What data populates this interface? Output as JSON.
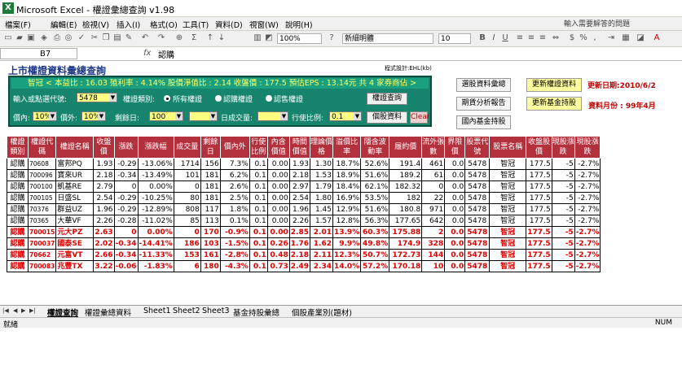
{
  "window": {
    "title": "Microsoft Excel - 權證彙總查詢 v1.98"
  },
  "menu": [
    "檔案(F)",
    "編輯(E)",
    "檢視(V)",
    "插入(I)",
    "格式(O)",
    "工具(T)",
    "資料(D)",
    "視窗(W)",
    "說明(H)"
  ],
  "help_box": "輸入需要解答的問題",
  "toolbar": {
    "zoom": "100%",
    "font_name": "新細明體",
    "font_size": "10"
  },
  "formula_bar": {
    "cell_ref": "B7",
    "fx": "fx",
    "value": "認購"
  },
  "page": {
    "title": "上市權證資料彙總查詢",
    "designer": "程式設計:EHL(kb)",
    "info_strip": "智冠 < 本益比 : 16.03 殖利率 : 4.14% 股價淨值比 : 2.14 收盤價 : 177.5 預估EPS : 13.14元 共 4 家券商佔 >",
    "update_date": "更新日期:2010/6/2",
    "data_month": "資料月份 : 99年4月"
  },
  "panel": {
    "code_label": "輸入或點選代號:",
    "code_value": "5478",
    "type_label": "權證類別:",
    "radio_all": "所有權證",
    "radio_call": "認購權證",
    "radio_put": "認售權證",
    "in_label": "價內:",
    "in_value": "10%",
    "out_label": "價外:",
    "out_value": "10%",
    "days_label": "剩餘日:",
    "days_value": "100",
    "tilde": "~",
    "volume_label": "日成交量:",
    "exercise_label": "行使比例:",
    "exercise_value": "0.1",
    "query_btn": "權證查詢",
    "info_btn": "個股資料",
    "clear_btn": "Clear"
  },
  "right_buttons": {
    "select_summary": "選股資料彙總",
    "futures_report": "期貨分析報告",
    "domestic_fund": "國內基金持股",
    "update_warrant": "更新權證資料",
    "update_fund": "更新基金持股"
  },
  "table": {
    "headers": [
      "權證類別",
      "權證代碼",
      "權證名稱",
      "收盤價",
      "漲跌",
      "漲跌幅",
      "成交量",
      "剩餘日",
      "價內外",
      "行使比例",
      "內含價值",
      "時間價值",
      "理論價格",
      "溢價比率",
      "隱含波動率",
      "履約價",
      "流外張數",
      "界限價",
      "股票代號",
      "股票名稱",
      "收盤股價",
      "現股漲跌",
      "現股漲跌"
    ],
    "rows": [
      [
        "認購",
        "70608",
        "富邦PQ",
        "1.93",
        "-0.29",
        "-13.06%",
        "1714",
        "156",
        "7.3%",
        "0.1",
        "0.00",
        "1.93",
        "1.30",
        "18.7%",
        "52.6%",
        "191.4",
        "461",
        "0.0",
        "5478",
        "智冠",
        "177.5",
        "-5",
        "-2.7%"
      ],
      [
        "認購",
        "700096",
        "寶來UR",
        "2.18",
        "-0.34",
        "-13.49%",
        "101",
        "181",
        "6.2%",
        "0.1",
        "0.00",
        "2.18",
        "1.53",
        "18.9%",
        "51.6%",
        "189.2",
        "61",
        "0.0",
        "5478",
        "智冠",
        "177.5",
        "-5",
        "-2.7%"
      ],
      [
        "認購",
        "700100",
        "凱基RE",
        "2.79",
        "0",
        "0.00%",
        "0",
        "181",
        "2.6%",
        "0.1",
        "0.00",
        "2.97",
        "1.79",
        "18.4%",
        "62.1%",
        "182.32",
        "0",
        "0.0",
        "5478",
        "智冠",
        "177.5",
        "-5",
        "-2.7%"
      ],
      [
        "認購",
        "700105",
        "日盛SL",
        "2.54",
        "-0.29",
        "-10.25%",
        "80",
        "181",
        "2.5%",
        "0.1",
        "0.00",
        "2.54",
        "1.80",
        "16.9%",
        "53.5%",
        "182",
        "22",
        "0.0",
        "5478",
        "智冠",
        "177.5",
        "-5",
        "-2.7%"
      ],
      [
        "認購",
        "70376",
        "群益UZ",
        "1.96",
        "-0.29",
        "-12.89%",
        "808",
        "117",
        "1.8%",
        "0.1",
        "0.00",
        "1.96",
        "1.45",
        "12.9%",
        "51.6%",
        "180.8",
        "971",
        "0.0",
        "5478",
        "智冠",
        "177.5",
        "-5",
        "-2.7%"
      ],
      [
        "認購",
        "70365",
        "大華VF",
        "2.26",
        "-0.28",
        "-11.02%",
        "85",
        "113",
        "0.1%",
        "0.1",
        "0.00",
        "2.26",
        "1.57",
        "12.8%",
        "56.3%",
        "177.65",
        "642",
        "0.0",
        "5478",
        "智冠",
        "177.5",
        "-5",
        "-2.7%"
      ],
      [
        "認購",
        "700015",
        "元大PZ",
        "2.63",
        "0",
        "0.00%",
        "0",
        "170",
        "-0.9%",
        "0.1",
        "0.00",
        "2.85",
        "2.01",
        "13.9%",
        "60.3%",
        "175.88",
        "2",
        "0.0",
        "5478",
        "智冠",
        "177.5",
        "-5",
        "-2.7%"
      ],
      [
        "認購",
        "700037",
        "國泰SE",
        "2.02",
        "-0.34",
        "-14.41%",
        "186",
        "103",
        "-1.5%",
        "0.1",
        "0.26",
        "1.76",
        "1.62",
        "9.9%",
        "49.8%",
        "174.9",
        "328",
        "0.0",
        "5478",
        "智冠",
        "177.5",
        "-5",
        "-2.7%"
      ],
      [
        "認購",
        "70662",
        "元富VT",
        "2.66",
        "-0.34",
        "-11.33%",
        "153",
        "161",
        "-2.8%",
        "0.1",
        "0.48",
        "2.18",
        "2.11",
        "12.3%",
        "50.7%",
        "172.73",
        "144",
        "0.0",
        "5478",
        "智冠",
        "177.5",
        "-5",
        "-2.7%"
      ],
      [
        "認購",
        "700083",
        "兆豐TX",
        "3.22",
        "-0.06",
        "-1.83%",
        "6",
        "180",
        "-4.3%",
        "0.1",
        "0.73",
        "2.49",
        "2.34",
        "14.0%",
        "57.2%",
        "170.18",
        "10",
        "0.0",
        "5478",
        "智冠",
        "177.5",
        "-5",
        "-2.7%"
      ]
    ],
    "red_rows_from": 6
  },
  "sheet_tabs": [
    "權證查詢",
    "權證彙總資料",
    "Sheet1",
    "Sheet2",
    "Sheet3",
    "基金持股彙總",
    "個股產業別(題材)"
  ],
  "status": {
    "left": "就緒",
    "right": "NUM"
  }
}
